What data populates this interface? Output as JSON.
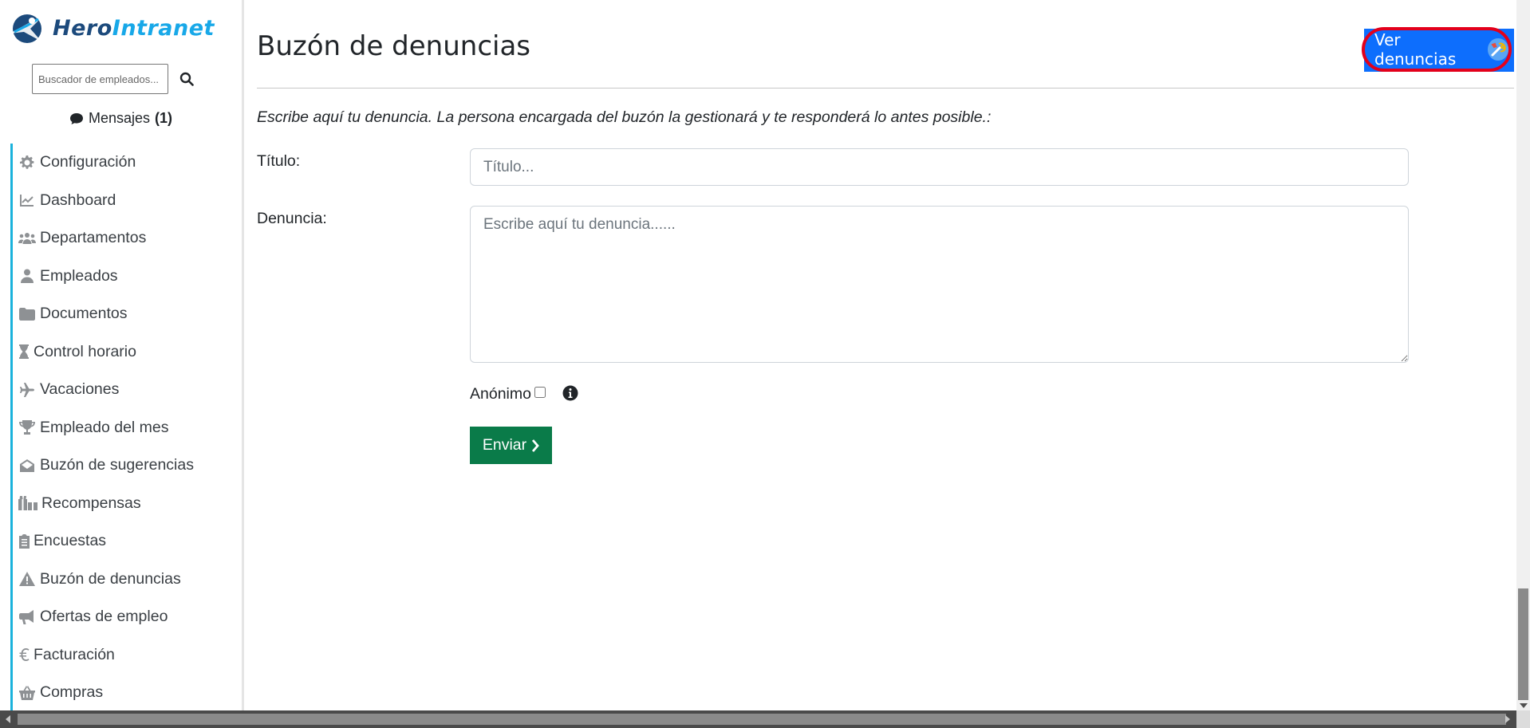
{
  "brand": {
    "hero": "Hero",
    "intranet": "Intranet"
  },
  "search": {
    "placeholder": "Buscador de empleados..."
  },
  "messages": {
    "label": "Mensajes",
    "count": "(1)"
  },
  "sidebar": {
    "items": [
      {
        "label": "Configuración",
        "icon": "gear-icon"
      },
      {
        "label": "Dashboard",
        "icon": "chart-line-icon"
      },
      {
        "label": "Departamentos",
        "icon": "users-icon"
      },
      {
        "label": "Empleados",
        "icon": "user-icon"
      },
      {
        "label": "Documentos",
        "icon": "folder-icon"
      },
      {
        "label": "Control horario",
        "icon": "hourglass-icon"
      },
      {
        "label": "Vacaciones",
        "icon": "plane-icon"
      },
      {
        "label": "Empleado del mes",
        "icon": "trophy-icon"
      },
      {
        "label": "Buzón de sugerencias",
        "icon": "envelope-open-icon"
      },
      {
        "label": "Recompensas",
        "icon": "gifts-icon"
      },
      {
        "label": "Encuestas",
        "icon": "clipboard-list-icon"
      },
      {
        "label": "Buzón de denuncias",
        "icon": "warning-icon"
      },
      {
        "label": "Ofertas de empleo",
        "icon": "bullhorn-icon"
      },
      {
        "label": "Facturación",
        "icon": "euro-icon"
      },
      {
        "label": "Compras",
        "icon": "basket-icon"
      }
    ]
  },
  "main": {
    "title": "Buzón de denuncias",
    "ver_button": "Ver denuncias",
    "intro": "Escribe aquí tu denuncia. La persona encargada del buzón la gestionará y te responderá lo antes posible.:",
    "title_label": "Título:",
    "title_placeholder": "Título...",
    "denuncia_label": "Denuncia:",
    "denuncia_placeholder": "Escribe aquí tu denuncia......",
    "anon_label": "Anónimo",
    "submit_label": "Enviar"
  },
  "colors": {
    "accent": "#0d6efd",
    "highlight": "#e3001b",
    "submit": "#0a7b49",
    "nav_border": "#1ab2dc"
  }
}
